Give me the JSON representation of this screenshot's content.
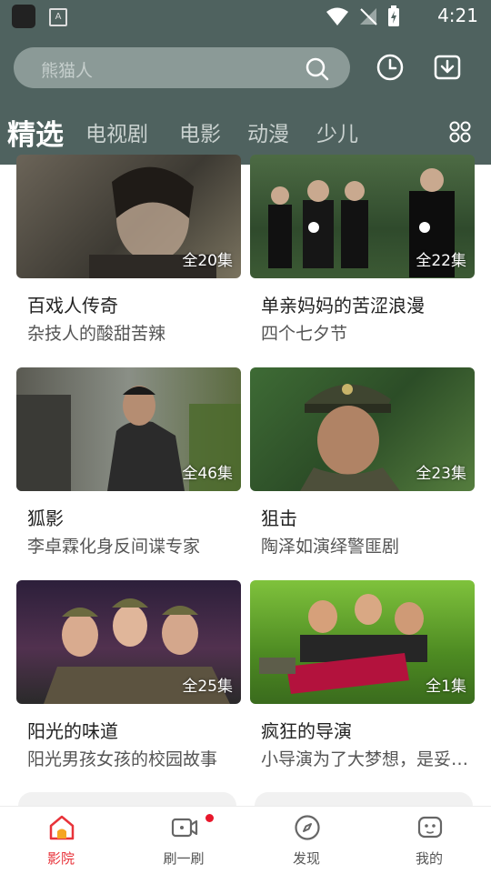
{
  "status_bar": {
    "time": "4:21",
    "app_icon_letter": "A"
  },
  "search": {
    "placeholder": "熊猫人"
  },
  "header_buttons": {
    "history": "clock-icon",
    "download": "download-icon"
  },
  "tabs": [
    {
      "label": "精选",
      "active": true
    },
    {
      "label": "电视剧",
      "active": false
    },
    {
      "label": "电影",
      "active": false
    },
    {
      "label": "动漫",
      "active": false
    },
    {
      "label": "少儿",
      "active": false
    }
  ],
  "cards": [
    {
      "title": "百戏人传奇",
      "subtitle": "杂技人的酸甜苦辣",
      "episodes": "全20集"
    },
    {
      "title": "单亲妈妈的苦涩浪漫",
      "subtitle": "四个七夕节",
      "episodes": "全22集"
    },
    {
      "title": "狐影",
      "subtitle": "李卓霖化身反间谍专家",
      "episodes": "全46集"
    },
    {
      "title": "狙击",
      "subtitle": "陶泽如演绎警匪剧",
      "episodes": "全23集"
    },
    {
      "title": "阳光的味道",
      "subtitle": "阳光男孩女孩的校园故事",
      "episodes": "全25集"
    },
    {
      "title": "疯狂的导演",
      "subtitle": "小导演为了大梦想，是妥协...",
      "episodes": "全1集"
    }
  ],
  "bottom_nav": [
    {
      "label": "影院",
      "active": true
    },
    {
      "label": "刷一刷",
      "active": false
    },
    {
      "label": "发现",
      "active": false
    },
    {
      "label": "我的",
      "active": false
    }
  ],
  "colors": {
    "header": "#4f625f",
    "accent": "#e8333a"
  }
}
